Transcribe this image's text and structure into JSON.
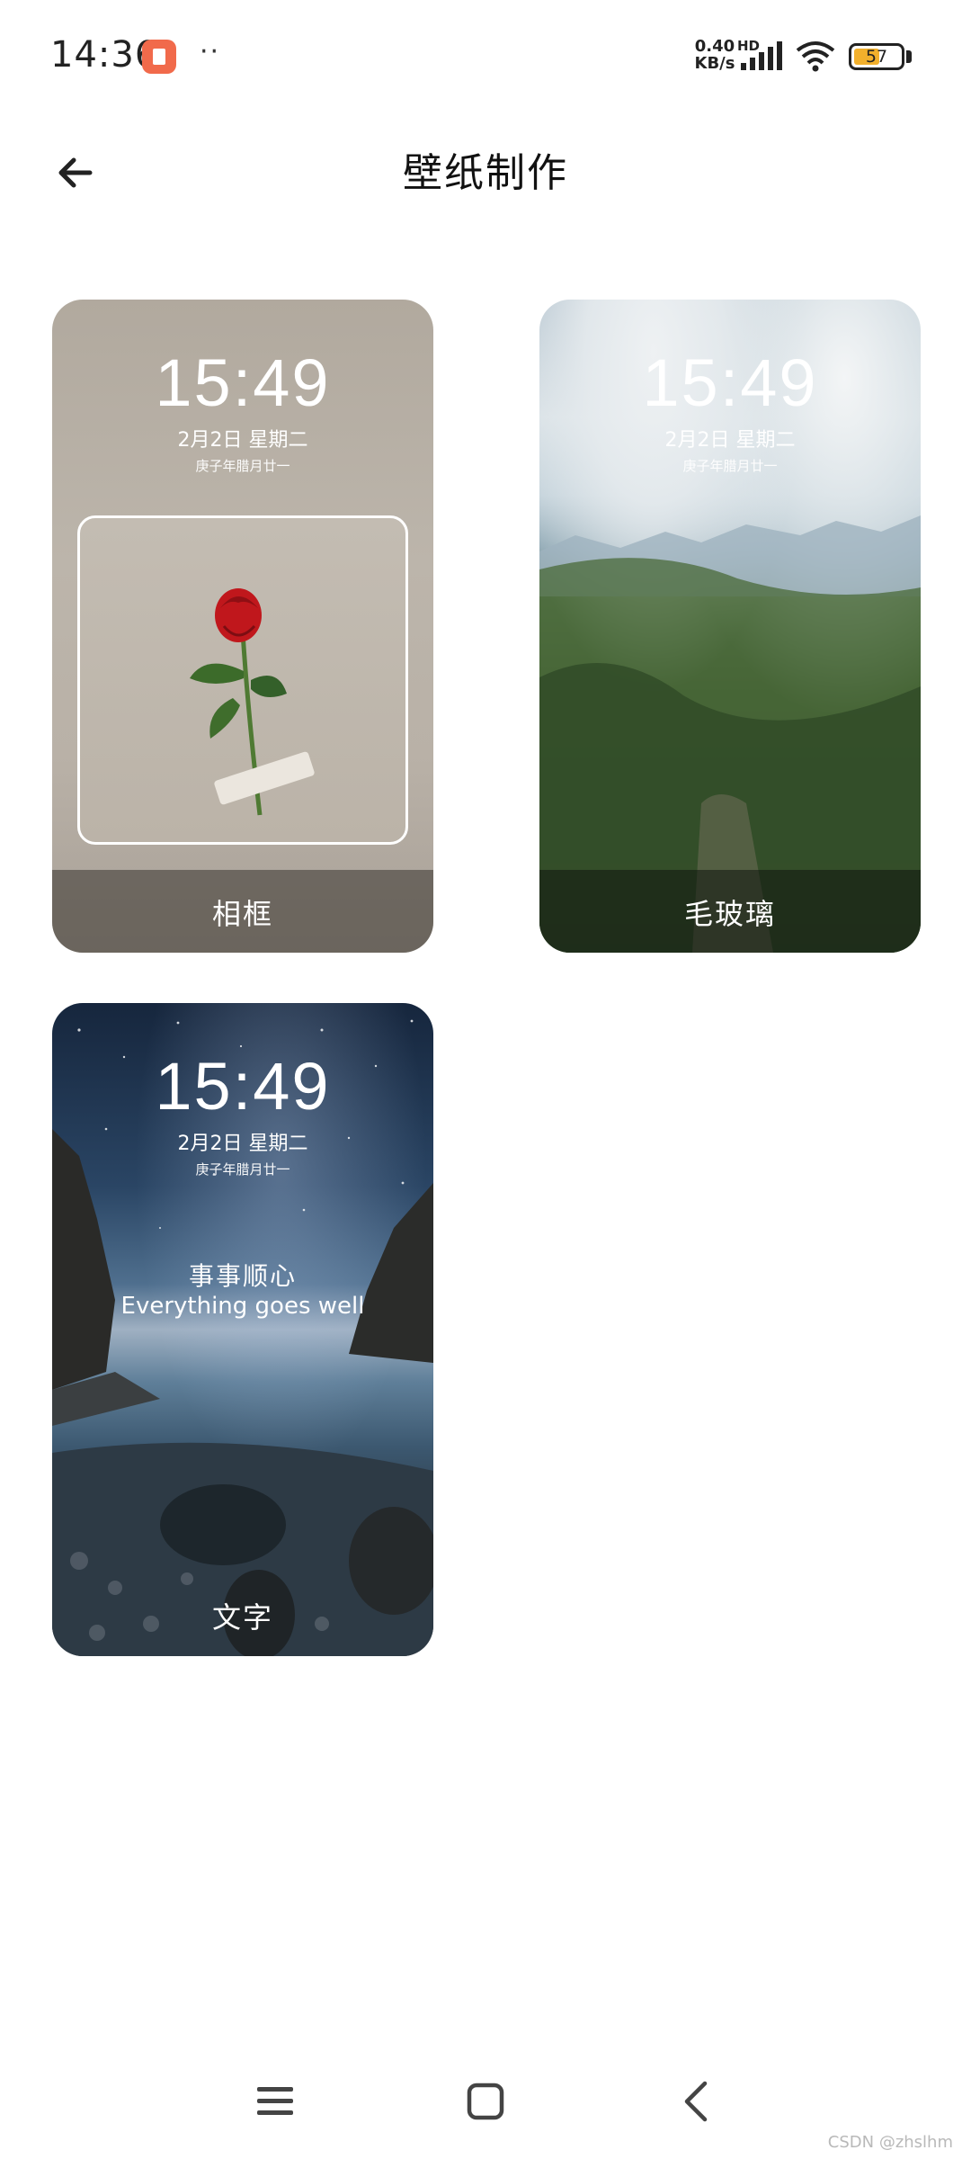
{
  "status_bar": {
    "time": "14:36",
    "dots": "··",
    "net_speed_value": "0.40",
    "net_speed_unit": "KB/s",
    "hd": "HD",
    "battery": "57"
  },
  "header": {
    "title": "壁纸制作"
  },
  "cards": [
    {
      "clock": "15:49",
      "date": "2月2日 星期二",
      "lunar": "庚子年腊月廿一",
      "label": "相框"
    },
    {
      "clock": "15:49",
      "date": "2月2日 星期二",
      "lunar": "庚子年腊月廿一",
      "label": "毛玻璃"
    },
    {
      "clock": "15:49",
      "date": "2月2日 星期二",
      "lunar": "庚子年腊月廿一",
      "motto_cn": "事事顺心",
      "motto_en": "Everything goes well",
      "label": "文字"
    }
  ],
  "watermark": "CSDN @zhslhm",
  "colors": {
    "status_icon": "#f16a4b",
    "battery_fill": "#f2b02c"
  }
}
